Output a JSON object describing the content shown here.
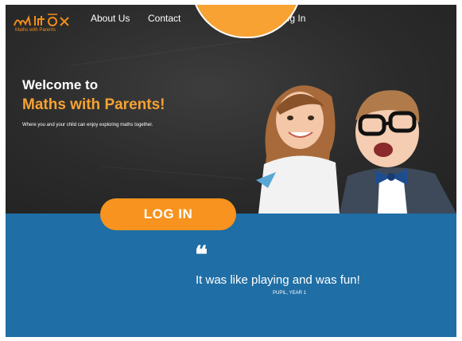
{
  "nav": {
    "logo_text": "Maths with Parents",
    "links": [
      "About Us",
      "Contact",
      "Log In"
    ]
  },
  "hero": {
    "welcome_line1": "Welcome to",
    "welcome_line2": "Maths with Parents!",
    "tagline": "Where you and your child can enjoy exploring maths together."
  },
  "cta": {
    "login_label": "LOG IN"
  },
  "testimonial": {
    "quote_mark": "❝",
    "quote": "It was like playing and was fun!",
    "author": "PUPIL, YEAR 1"
  },
  "colors": {
    "accent_orange": "#f7931e",
    "band_blue": "#1f6ea5",
    "hero_dark": "#2c2c2c"
  }
}
